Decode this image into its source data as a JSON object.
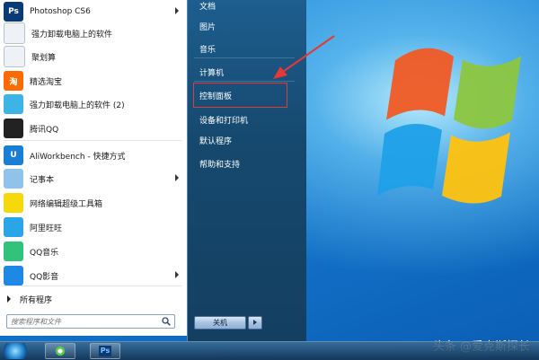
{
  "left_programs": [
    {
      "label": "Photoshop CS6",
      "icon": "photoshop-icon",
      "icon_text": "Ps",
      "color": "#0b3b76",
      "submenu": true
    },
    {
      "label": "强力卸载电脑上的软件",
      "icon": "document-icon",
      "icon_text": "",
      "color": "#eef2f6",
      "submenu": false
    },
    {
      "label": "聚划算",
      "icon": "document-icon",
      "icon_text": "",
      "color": "#eef2f6",
      "submenu": false
    },
    {
      "label": "精选淘宝",
      "icon": "taobao-icon",
      "icon_text": "淘",
      "color": "#ff6a00",
      "submenu": false
    },
    {
      "label": "强力卸载电脑上的软件 (2)",
      "icon": "pinwheel-icon",
      "icon_text": "",
      "color": "#3cb4e5",
      "submenu": false
    },
    {
      "label": "腾讯QQ",
      "icon": "qq-penguin-icon",
      "icon_text": "",
      "color": "#222222",
      "submenu": false
    },
    {
      "label": "AliWorkbench - 快捷方式",
      "icon": "aliworkbench-icon",
      "icon_text": "U",
      "color": "#1a7fd4",
      "submenu": false
    },
    {
      "label": "记事本",
      "icon": "notepad-icon",
      "icon_text": "",
      "color": "#8fc3ea",
      "submenu": true
    },
    {
      "label": "网络编辑超级工具箱",
      "icon": "toolbox-icon",
      "icon_text": "",
      "color": "#f5d90a",
      "submenu": false
    },
    {
      "label": "阿里旺旺",
      "icon": "aliwangwang-icon",
      "icon_text": "",
      "color": "#2aa6e8",
      "submenu": false
    },
    {
      "label": "QQ音乐",
      "icon": "qq-music-icon",
      "icon_text": "",
      "color": "#31c27c",
      "submenu": false
    },
    {
      "label": "QQ影音",
      "icon": "qq-player-icon",
      "icon_text": "",
      "color": "#1e88e5",
      "submenu": true
    }
  ],
  "all_programs_label": "所有程序",
  "search_placeholder": "搜索程序和文件",
  "right_items": [
    "文档",
    "图片",
    "音乐",
    "计算机",
    "控制面板",
    "设备和打印机",
    "默认程序",
    "帮助和支持"
  ],
  "shutdown_label": "关机",
  "taskbar": {
    "buttons": [
      "start-orb",
      "ie-icon",
      "photoshop-icon"
    ],
    "ps_label": "Ps"
  },
  "watermark": "头条 @爱克斯探长",
  "colors": {
    "highlight": "#e53935",
    "start_menu_right": "#1d5e8f",
    "desktop": "#1479cf"
  }
}
